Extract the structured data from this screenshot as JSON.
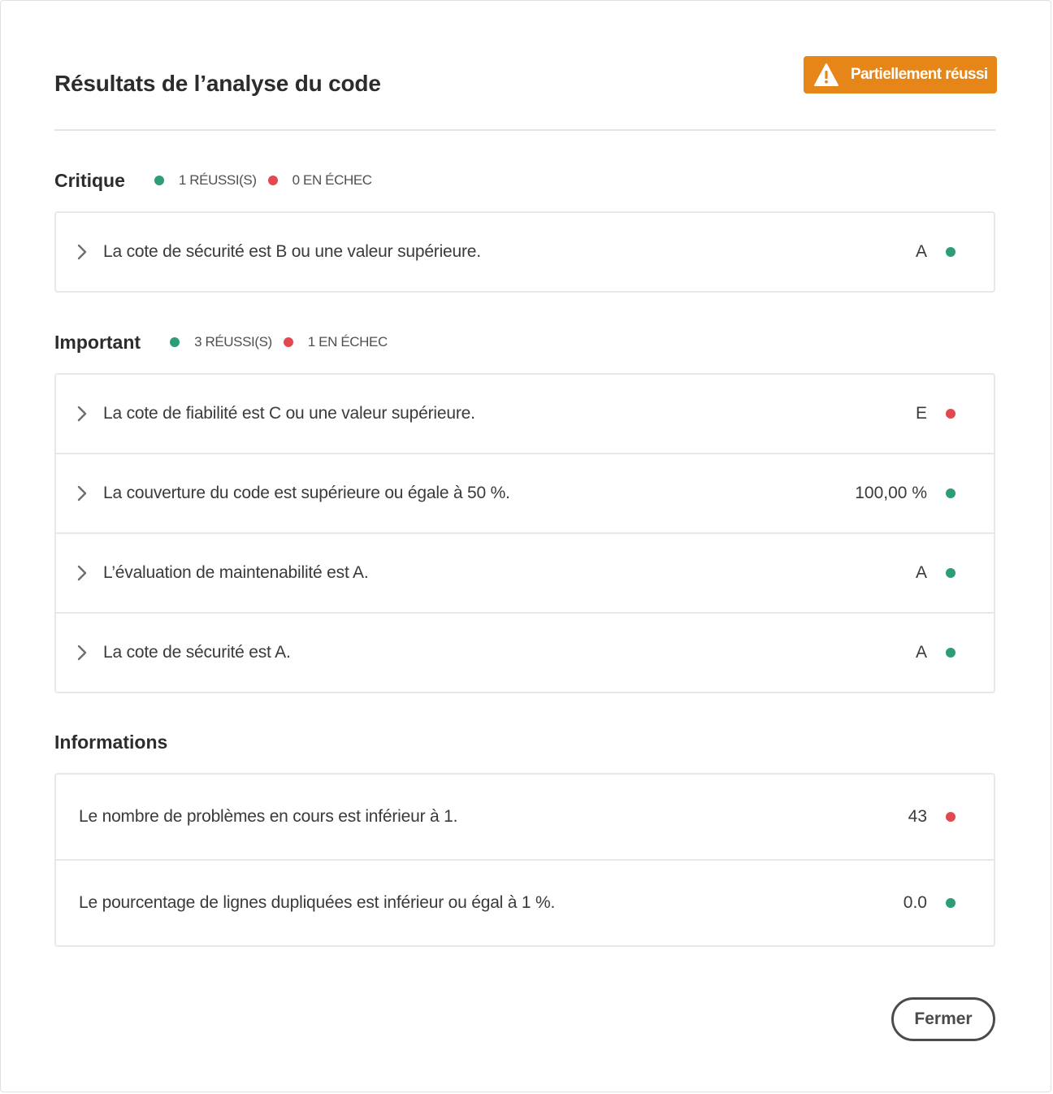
{
  "dialog": {
    "title": "Résultats de l’analyse du code",
    "status_badge": {
      "label": "Partiellement réussi",
      "icon": "warning-icon",
      "color": "#e68619"
    },
    "close_label": "Fermer"
  },
  "colors": {
    "pass": "#2d9d78",
    "fail": "#e34850"
  },
  "sections": {
    "critical": {
      "title": "Critique",
      "passed": "1 RÉUSSI(S)",
      "failed": "0 EN ÉCHEC",
      "rows": [
        {
          "label": "La cote de sécurité est B ou une valeur supérieure.",
          "value": "A",
          "status": "pass"
        }
      ]
    },
    "important": {
      "title": "Important",
      "passed": "3 RÉUSSI(S)",
      "failed": "1 EN ÉCHEC",
      "rows": [
        {
          "label": "La cote de fiabilité est C ou une valeur supérieure.",
          "value": "E",
          "status": "fail"
        },
        {
          "label": "La couverture du code est supérieure ou égale à 50 %.",
          "value": "100,00 %",
          "status": "pass"
        },
        {
          "label": "L’évaluation de maintenabilité est A.",
          "value": "A",
          "status": "pass"
        },
        {
          "label": "La cote de sécurité est A.",
          "value": "A",
          "status": "pass"
        }
      ]
    },
    "info": {
      "title": "Informations",
      "rows": [
        {
          "label": "Le nombre de problèmes en cours est inférieur à 1.",
          "value": "43",
          "status": "fail"
        },
        {
          "label": "Le pourcentage de lignes dupliquées est inférieur ou égal à 1 %.",
          "value": "0.0",
          "status": "pass"
        }
      ]
    }
  }
}
